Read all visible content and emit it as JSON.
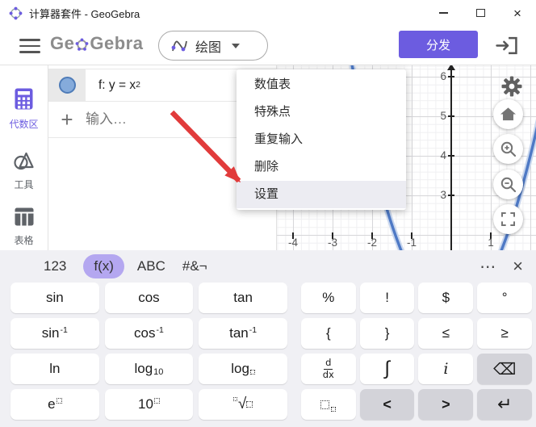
{
  "window": {
    "title": "计算器套件 - GeoGebra"
  },
  "header": {
    "logo_prefix": "Ge",
    "logo_suffix": "Gebra",
    "mode_label": "绘图",
    "share_label": "分发"
  },
  "sidebar": {
    "items": [
      {
        "label": "代数区",
        "active": true
      },
      {
        "label": "工具",
        "active": false
      },
      {
        "label": "表格",
        "active": false
      }
    ]
  },
  "algebra": {
    "rows": [
      {
        "formula_base": "f:  y = x",
        "exponent": "2"
      }
    ],
    "input_placeholder": "输入…"
  },
  "context_menu": {
    "items": [
      "数值表",
      "特殊点",
      "重复输入",
      "删除",
      "设置"
    ],
    "highlighted": "设置"
  },
  "graph": {
    "function": "y = x^2",
    "curve_color": "#4e79c5",
    "y_labels": [
      "6",
      "5",
      "4",
      "3"
    ],
    "x_labels": [
      "-4",
      "-3",
      "-2",
      "-1",
      "1"
    ]
  },
  "keyboard": {
    "tabs": [
      "123",
      "f(x)",
      "ABC",
      "#&¬"
    ],
    "active_tab": "f(x)",
    "more": "⋯",
    "close": "×",
    "keys": {
      "sin": "sin",
      "cos": "cos",
      "tan": "tan",
      "percent": "%",
      "factorial": "!",
      "dollar": "$",
      "degree": "°",
      "inverse_sup": "-1",
      "open_brace": "{",
      "close_brace": "}",
      "leq": "≤",
      "geq": "≥",
      "ln": "ln",
      "log": "log",
      "log10_sub": "10",
      "frac_num": "d",
      "frac_den": "dx",
      "integral": "∫",
      "imaginary": "i",
      "backspace": "⌫",
      "e": "e",
      "ten": "10",
      "root": "√",
      "left": "<",
      "right": ">",
      "enter": "↵"
    }
  }
}
